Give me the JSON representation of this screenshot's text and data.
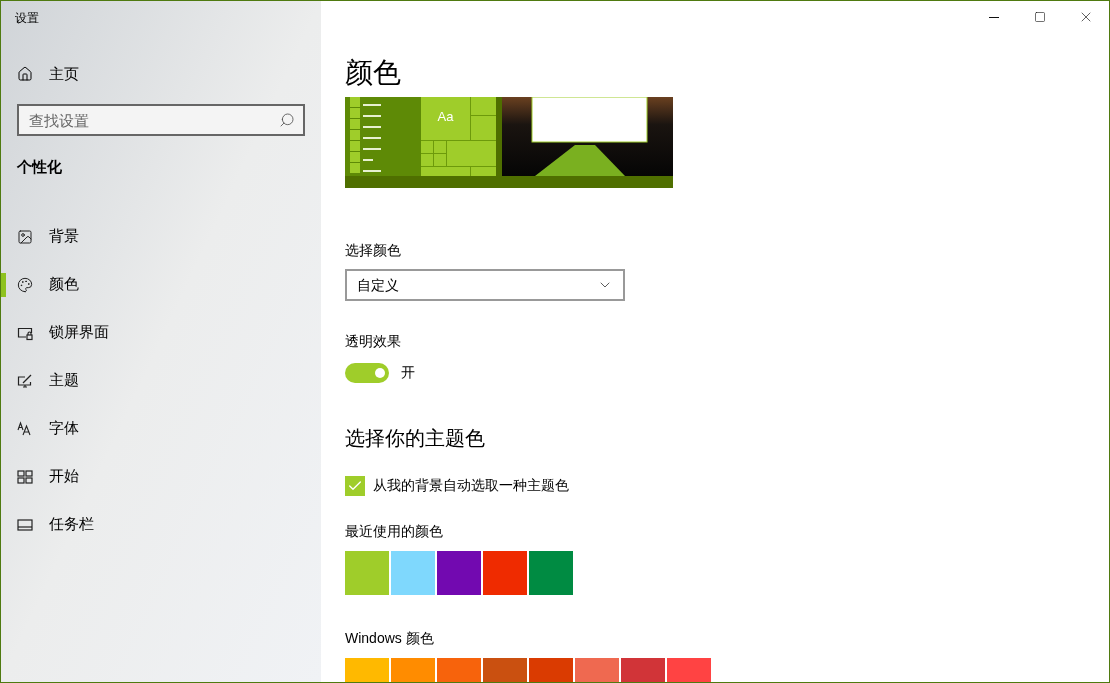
{
  "window": {
    "title": "设置"
  },
  "sidebar": {
    "home": "主页",
    "search": {
      "placeholder": "查找设置"
    },
    "section": "个性化",
    "items": [
      {
        "label": "背景",
        "kind": "image",
        "selected": false
      },
      {
        "label": "颜色",
        "kind": "palette",
        "selected": true
      },
      {
        "label": "锁屏界面",
        "kind": "lock",
        "selected": false
      },
      {
        "label": "主题",
        "kind": "theme",
        "selected": false
      },
      {
        "label": "字体",
        "kind": "font",
        "selected": false
      },
      {
        "label": "开始",
        "kind": "start",
        "selected": false
      },
      {
        "label": "任务栏",
        "kind": "taskbar",
        "selected": false
      }
    ]
  },
  "page": {
    "title": "颜色",
    "preview": {
      "tile_label": "Aa"
    },
    "color_choice": {
      "label": "选择颜色",
      "value": "自定义"
    },
    "transparency": {
      "label": "透明效果",
      "on": true,
      "state_label": "开"
    },
    "accent": {
      "heading": "选择你的主题色",
      "auto": {
        "label": "从我的背景自动选取一种主题色",
        "checked": true
      },
      "recent_label": "最近使用的颜色",
      "recent": [
        {
          "color": "#9fcd2a"
        },
        {
          "color": "#7fd8fd"
        },
        {
          "color": "#7209b0"
        },
        {
          "color": "#ef2b00"
        },
        {
          "color": "#008b42"
        }
      ],
      "windows_label": "Windows 颜色",
      "windows": [
        {
          "color": "#ffb900"
        },
        {
          "color": "#ff8c00"
        },
        {
          "color": "#f7630c"
        },
        {
          "color": "#ca5010"
        },
        {
          "color": "#da3b01"
        },
        {
          "color": "#ef6950"
        },
        {
          "color": "#d13438"
        },
        {
          "color": "#ff4343"
        }
      ]
    }
  }
}
